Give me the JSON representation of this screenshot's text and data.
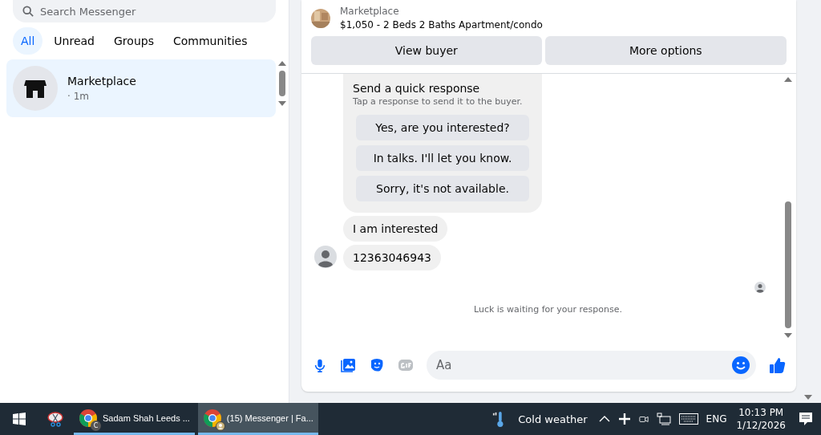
{
  "sidebar": {
    "search": {
      "placeholder": "Search Messenger"
    },
    "filters": [
      {
        "label": "All",
        "selected": true
      },
      {
        "label": "Unread",
        "selected": false
      },
      {
        "label": "Groups",
        "selected": false
      },
      {
        "label": "Communities",
        "selected": false
      }
    ],
    "chats": [
      {
        "name": "Marketplace",
        "time": "· 1m",
        "selected": true
      }
    ]
  },
  "listing": {
    "source": "Marketplace",
    "title": "$1,050 - 2 Beds 2 Baths Apartment/condo",
    "buttons": [
      "View buyer",
      "More options"
    ]
  },
  "quick_response": {
    "title": "Send a quick response",
    "subtitle": "Tap a response to send it to the buyer.",
    "options": [
      "Yes, are you interested?",
      "In talks. I'll let you know.",
      "Sorry, it's not available."
    ]
  },
  "messages": [
    {
      "text": "I am interested"
    },
    {
      "text": "12363046943"
    }
  ],
  "waiting_note": "Luck is waiting for your response.",
  "composer": {
    "placeholder": "Aa"
  },
  "taskbar": {
    "apps": [
      {
        "label": "Sadam Shah Leeds ...",
        "selected": false,
        "badge": "C"
      },
      {
        "label": "(15) Messenger | Fa...",
        "selected": true
      }
    ],
    "weather": "Cold weather",
    "language": "ENG",
    "time": "10:13 PM",
    "date": "1/12/2026"
  }
}
